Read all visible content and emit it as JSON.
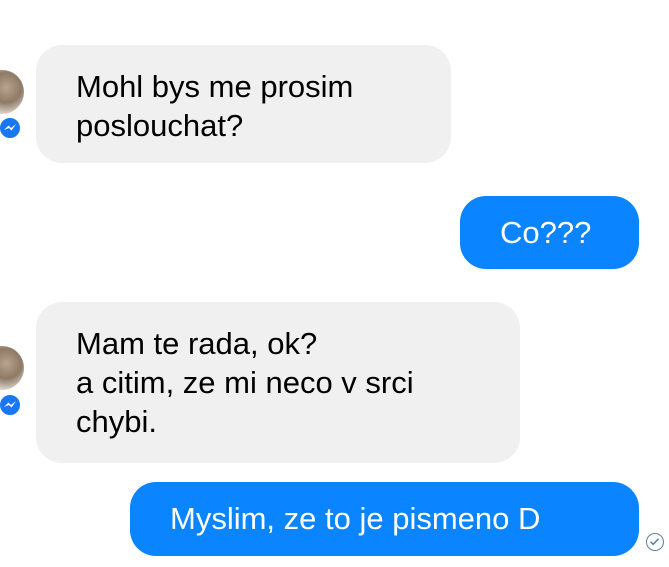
{
  "conversation": {
    "messages": [
      {
        "direction": "incoming",
        "lines": [
          "Mohl bys me prosim",
          "poslouchat?"
        ]
      },
      {
        "direction": "outgoing",
        "lines": [
          "Co???"
        ]
      },
      {
        "direction": "incoming",
        "lines": [
          "Mam te rada, ok?",
          "a citim, ze mi neco v srci",
          "chybi."
        ]
      },
      {
        "direction": "outgoing",
        "lines": [
          "Myslim, ze to je pismeno D"
        ]
      }
    ]
  },
  "colors": {
    "incoming_bubble": "#f0f0f0",
    "outgoing_bubble": "#0a84ff",
    "messenger_badge": "#1877f2"
  },
  "icons": {
    "contact_avatar": "avatar",
    "messenger_badge": "messenger-icon",
    "delivered_status": "check-circle-icon"
  }
}
